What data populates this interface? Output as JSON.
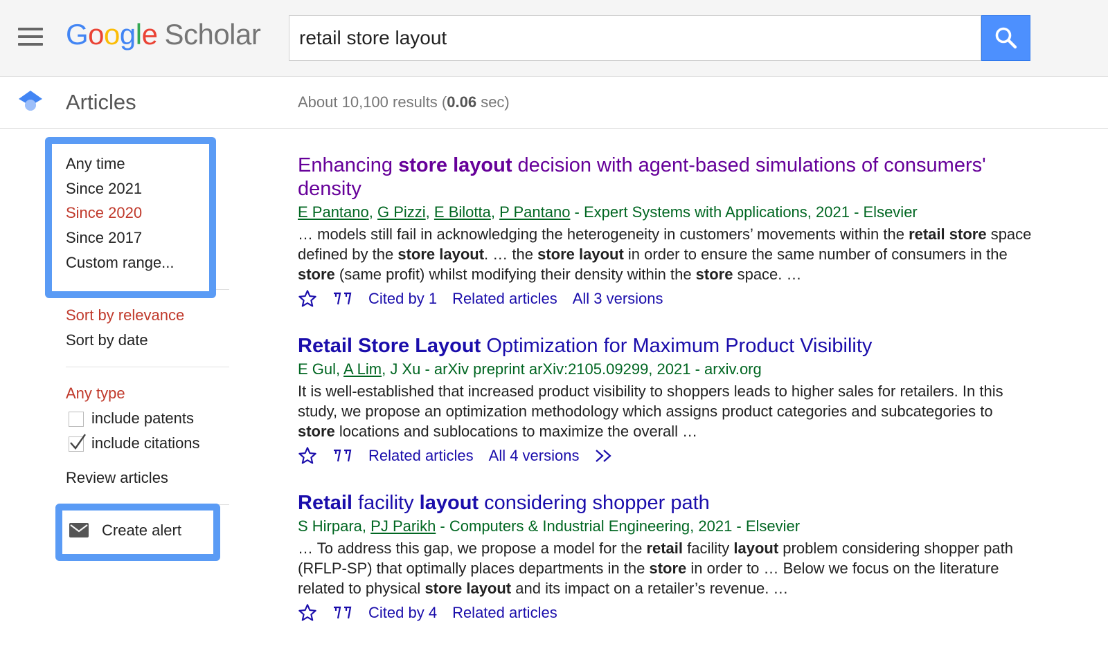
{
  "header": {
    "logo": {
      "g1": "G",
      "g2": "o",
      "g3": "o",
      "g4": "g",
      "g5": "l",
      "g6": "e",
      "product": "Scholar"
    },
    "search_value": "retail store layout",
    "icons": {
      "menu": "hamburger-menu-icon",
      "search": "magnifier-icon"
    }
  },
  "subheader": {
    "section": "Articles",
    "results_prefix": "About 10,100 results (",
    "results_time": "0.06",
    "results_suffix": " sec)"
  },
  "sidebar": {
    "time_filters": [
      "Any time",
      "Since 2021",
      "Since 2020",
      "Since 2017",
      "Custom range..."
    ],
    "time_active": "Since 2020",
    "sort": [
      "Sort by relevance",
      "Sort by date"
    ],
    "sort_active": "Sort by relevance",
    "type": "Any type",
    "checkboxes": [
      {
        "label": "include patents",
        "checked": false
      },
      {
        "label": "include citations",
        "checked": true
      }
    ],
    "review": "Review articles",
    "create_alert": "Create alert"
  },
  "results": [
    {
      "title_parts": [
        "Enhancing ",
        "store layout",
        " decision with agent-based simulations of consumers' density"
      ],
      "authors": [
        "E Pantano",
        ", ",
        "G Pizzi",
        ", ",
        "E Bilotta",
        ", ",
        "P Pantano"
      ],
      "venue": " - Expert Systems with Applications, 2021 - Elsevier",
      "snippet": [
        "… models still fail in acknowledging the heterogeneity in customers’ movements within the ",
        "retail",
        " ",
        "store",
        " space defined by the ",
        "store layout",
        ". … the ",
        "store layout",
        " in order to ensure the same number of consumers in the ",
        "store",
        " (same profit) whilst modifying their density within the ",
        "store",
        " space. …"
      ],
      "actions": [
        "Cited by 1",
        "Related articles",
        "All 3 versions"
      ]
    },
    {
      "title_parts": [
        "Retail Store Layout",
        " Optimization for Maximum Product Visibility"
      ],
      "authors": [
        "E Gul",
        ", ",
        "A Lim",
        ", ",
        "J Xu"
      ],
      "venue": " - arXiv preprint arXiv:2105.09299, 2021 - arxiv.org",
      "snippet": [
        "It is well-established that increased product visibility to shoppers leads to higher sales for retailers. In this study, we propose an optimization methodology which assigns product categories and subcategories to ",
        "store",
        " locations and sublocations to maximize the overall …"
      ],
      "actions": [
        "Related articles",
        "All 4 versions"
      ]
    },
    {
      "title_parts": [
        "Retail",
        " facility ",
        "layout",
        " considering shopper path"
      ],
      "authors": [
        "S Hirpara",
        ", ",
        "PJ Parikh"
      ],
      "venue": " - Computers & Industrial Engineering, 2021 - Elsevier",
      "snippet": [
        "… To address this gap, we propose a model for the ",
        "retail",
        " facility ",
        "layout",
        " problem considering shopper path (RFLP-SP) that optimally places departments in the ",
        "store",
        " in order to … Below we focus on the literature related to physical ",
        "store layout",
        " and its impact on a retailer’s revenue. …"
      ],
      "actions": [
        "Cited by 4",
        "Related articles"
      ]
    }
  ],
  "colors": {
    "visited_title": "#660099",
    "link": "#1a0dab",
    "meta_green": "#006621",
    "active_red": "#c0392b",
    "highlight_blue": "#5a9bf5",
    "search_button": "#4d90fe"
  }
}
